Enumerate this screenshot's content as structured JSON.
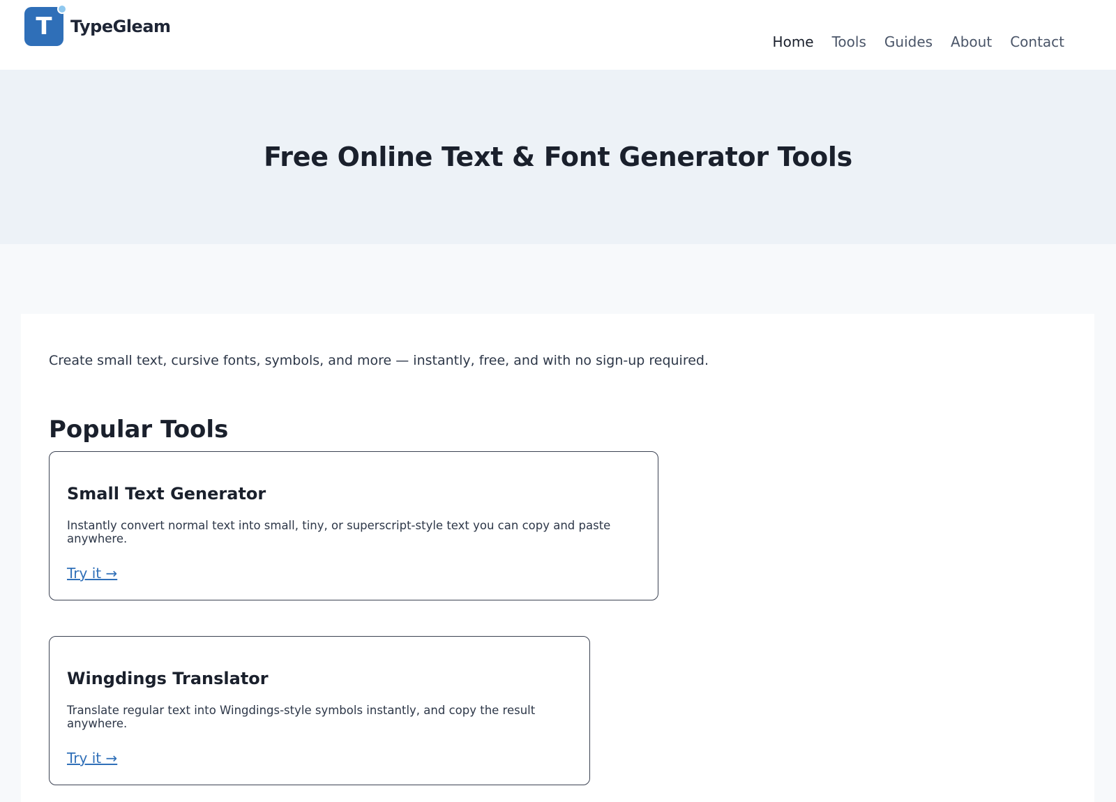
{
  "brand": {
    "name": "TypeGleam",
    "logo_letter": "T",
    "logo_color": "#2f6fb8",
    "logo_dot_color": "#8fc8ef"
  },
  "nav": {
    "items": [
      {
        "label": "Home",
        "active": true
      },
      {
        "label": "Tools",
        "active": false
      },
      {
        "label": "Guides",
        "active": false
      },
      {
        "label": "About",
        "active": false
      },
      {
        "label": "Contact",
        "active": false
      }
    ]
  },
  "hero": {
    "title": "Free Online Text & Font Generator Tools",
    "background": "#edf2f7"
  },
  "main": {
    "intro": "Create small text, cursive fonts, symbols, and more — instantly, free, and with no sign-up required.",
    "section_title": "Popular Tools",
    "tools": [
      {
        "title": "Small Text Generator",
        "description": "Instantly convert normal text into small, tiny, or superscript-style text you can copy and paste anywhere.",
        "link_label": "Try it →"
      },
      {
        "title": "Wingdings Translator",
        "description": "Translate regular text into Wingdings-style symbols instantly, and copy the result anywhere.",
        "link_label": "Try it →"
      }
    ]
  },
  "colors": {
    "link": "#2f6fb8",
    "text": "#1a202c",
    "page_background": "#f7f9fb"
  }
}
